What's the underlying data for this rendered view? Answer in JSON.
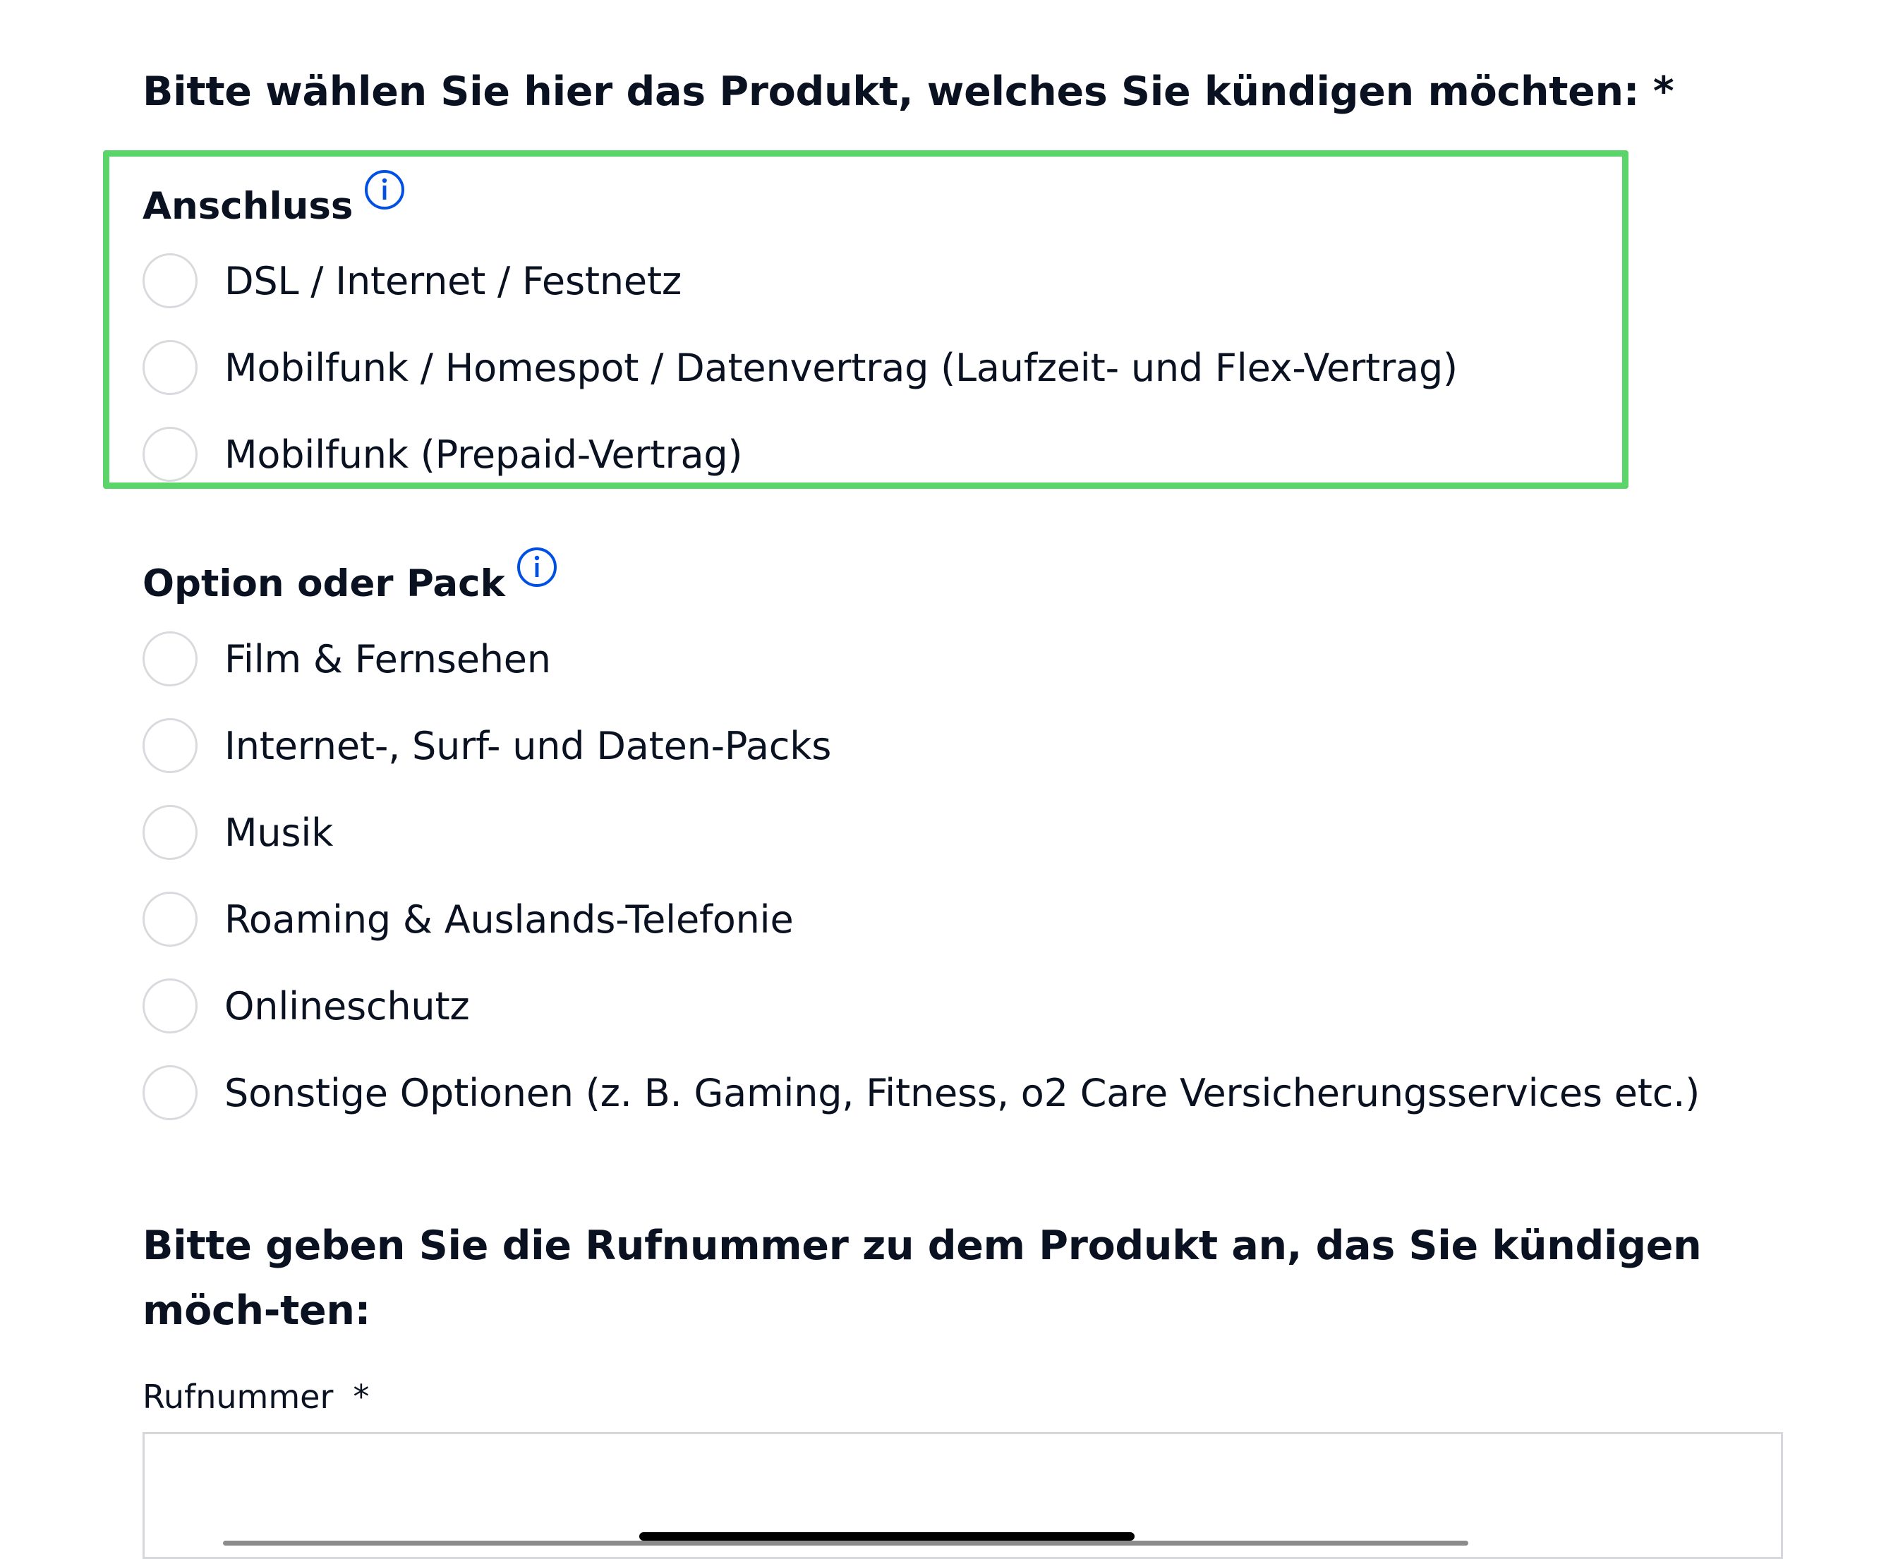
{
  "product_question": "Bitte wählen Sie hier das Produkt, welches Sie kündigen möchten: *",
  "anschluss": {
    "title": "Anschluss",
    "info_icon": "info-circle-icon",
    "options": [
      "DSL / Internet / Festnetz",
      "Mobilfunk / Homespot / Datenvertrag (Laufzeit- und Flex-Vertrag)",
      "Mobilfunk (Prepaid-Vertrag)"
    ]
  },
  "option_pack": {
    "title": "Option oder Pack",
    "info_icon": "info-circle-icon",
    "options": [
      "Film & Fernsehen",
      "Internet-, Surf- und Daten-Packs",
      "Musik",
      "Roaming & Auslands-Telefonie",
      "Onlineschutz",
      "Sonstige Optionen (z. B. Gaming, Fitness, o2 Care Versicherungsservices etc.)"
    ]
  },
  "phone_question": "Bitte geben Sie die Rufnummer zu dem Produkt an, das Sie kündigen möch-ten:",
  "phone_field": {
    "label": "Rufnummer",
    "required_marker": "*",
    "value": ""
  },
  "colors": {
    "highlight": "#5bd46a",
    "info_icon": "#0050e6",
    "text": "#0a1222",
    "radio_border": "#d8dadd"
  }
}
